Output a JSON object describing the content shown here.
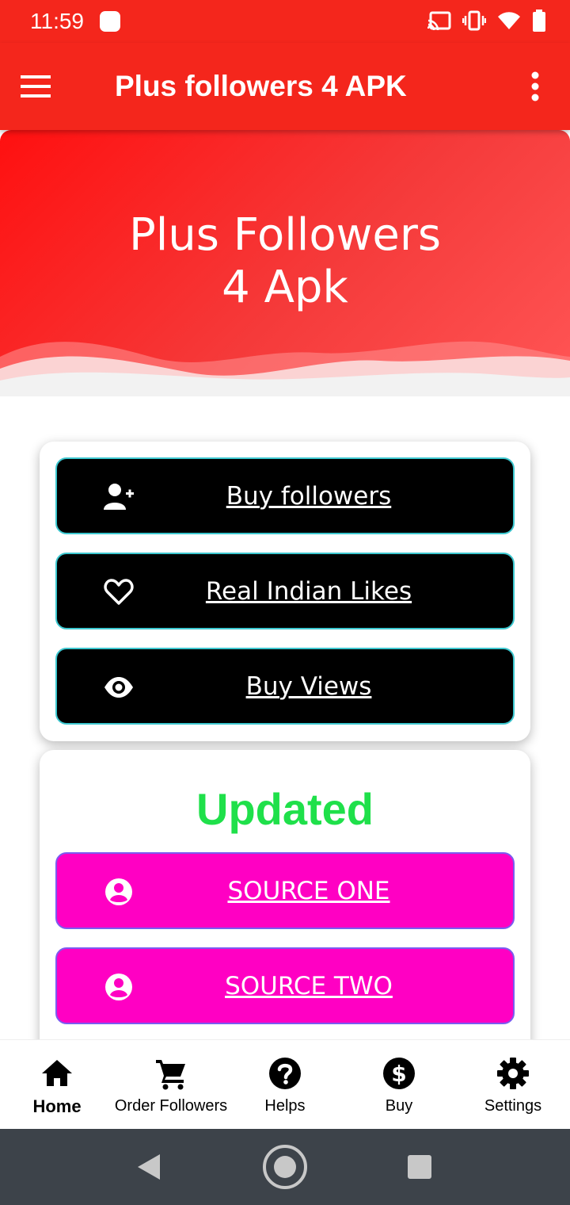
{
  "status_bar": {
    "time": "11:59"
  },
  "app_bar": {
    "title": "Plus followers 4 APK"
  },
  "hero": {
    "title_line1": "Plus Followers",
    "title_line2": "4 Apk"
  },
  "actions_card": {
    "buttons": [
      {
        "label": "Buy followers",
        "icon": "add-user-icon"
      },
      {
        "label": "Real Indian Likes",
        "icon": "heart-icon"
      },
      {
        "label": "Buy Views",
        "icon": "eye-icon"
      }
    ]
  },
  "sources_card": {
    "title": "Updated",
    "buttons": [
      {
        "label": "SOURCE ONE",
        "icon": "account-circle-icon"
      },
      {
        "label": "SOURCE TWO",
        "icon": "account-circle-icon"
      }
    ]
  },
  "bottom_nav": {
    "items": [
      {
        "label": "Home",
        "icon": "home-icon",
        "active": true
      },
      {
        "label": "Order Followers",
        "icon": "cart-icon",
        "active": false
      },
      {
        "label": "Helps",
        "icon": "help-icon",
        "active": false
      },
      {
        "label": "Buy",
        "icon": "dollar-icon",
        "active": false
      },
      {
        "label": "Settings",
        "icon": "gear-icon",
        "active": false
      }
    ]
  },
  "colors": {
    "primary": "#f4261c",
    "button_black": "#000000",
    "button_border_teal": "#3cc7cf",
    "button_pink": "#ff00c3",
    "updated_green": "#1fe04a",
    "system_nav": "#3d434a"
  }
}
